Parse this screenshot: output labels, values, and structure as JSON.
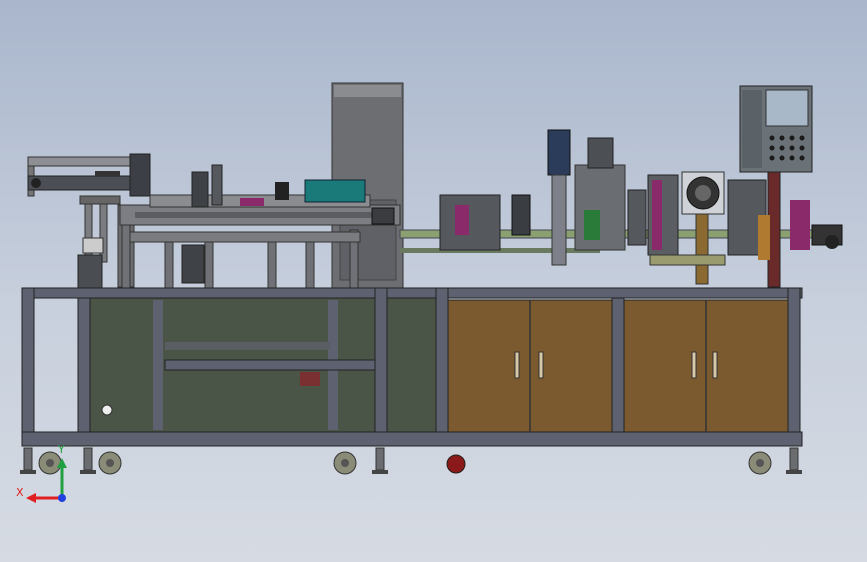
{
  "viewport": {
    "background_top": "#a9b6cc",
    "background_bottom": "#d6dbe3"
  },
  "triad": {
    "x_label": "X",
    "y_label": "Y",
    "x_color": "#e02020",
    "y_color": "#20a040",
    "z_color": "#2040e0"
  },
  "colors": {
    "frame": "#5e6270",
    "panel_green": "#4a5548",
    "panel_brown": "#7a5a2e",
    "column_gray": "#6c6e72",
    "machine_dark": "#3e4a44",
    "accent_magenta": "#8a2a6a",
    "accent_teal": "#1a7a7a"
  },
  "icons": [
    "coordinate-triad-icon",
    "caster-wheel-icon",
    "cabinet-handle-icon"
  ]
}
